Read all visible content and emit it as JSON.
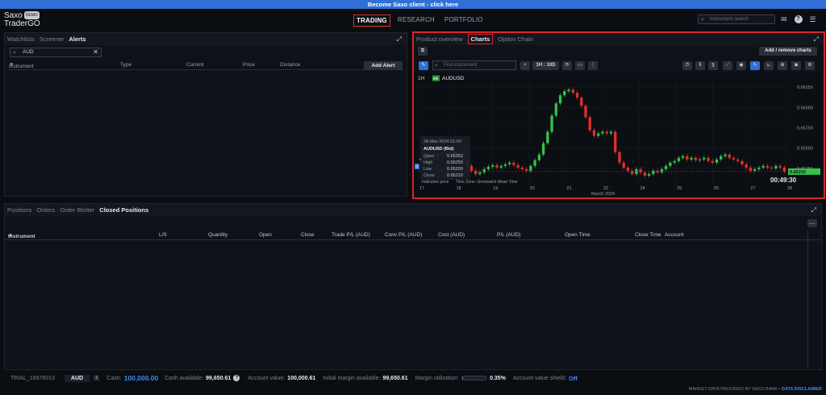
{
  "banner": {
    "text": "Become Saxo client - click here"
  },
  "logo": {
    "line1": "Saxo",
    "line2": "TraderGO",
    "badge": "DEMO"
  },
  "nav": {
    "items": [
      "TRADING",
      "RESEARCH",
      "PORTFOLIO"
    ],
    "active": "TRADING"
  },
  "top_search": {
    "placeholder": "Instrument search"
  },
  "icons": {
    "mail": "mail-icon",
    "help": "help-icon",
    "menu": "menu-icon",
    "expand": "expand-icon"
  },
  "left_panel": {
    "tabs": [
      "Watchlists",
      "Screener",
      "Alerts"
    ],
    "active_tab": "Alerts",
    "search_value": "AUD",
    "columns": [
      "Instrument",
      "Type",
      "Current",
      "Price",
      "Distance"
    ],
    "add_alert_label": "Add Alert"
  },
  "right_panel": {
    "tabs": [
      "Product overview",
      "Charts",
      "Option Chain"
    ],
    "active_tab": "Charts",
    "add_remove_label": "Add / remove charts",
    "find_placeholder": "Find instrument",
    "timeframe_label": "1H : 10D"
  },
  "chart": {
    "interval": "1H",
    "symbol_badge": "FX",
    "symbol": "AUDUSD",
    "tooltip": {
      "date": "28-Mar-2024 01:00",
      "title": "AUDUSD (Bid)",
      "rows": [
        {
          "label": "Open",
          "value": "0.65252"
        },
        {
          "label": "High",
          "value": "0.65255"
        },
        {
          "label": "Low",
          "value": "0.65209"
        },
        {
          "label": "Close",
          "value": "0.65210"
        }
      ]
    },
    "indicative": "Indicative price",
    "timezone": "Time Zone: Greenwich Mean Time",
    "countdown": "00:49:30",
    "current_price_label": "0.65210",
    "month_label": "March 2024"
  },
  "chart_data": {
    "type": "candlestick",
    "title": "AUDUSD",
    "x_ticks": [
      "17",
      "18",
      "19",
      "20",
      "21",
      "22",
      "24",
      "25",
      "26",
      "27",
      "28"
    ],
    "y_ticks": [
      0.6525,
      0.655,
      0.6575,
      0.66,
      0.6625
    ],
    "ylim": [
      0.6505,
      0.6638
    ],
    "current_price": 0.6521,
    "series": [
      {
        "name": "AUDUSD (Bid)",
        "values": [
          0.6537,
          0.6539,
          0.6541,
          0.654,
          0.6542,
          0.6543,
          0.6544,
          0.6546,
          0.6542,
          0.6538,
          0.6535,
          0.6528,
          0.6522,
          0.6518,
          0.652,
          0.6524,
          0.6527,
          0.6529,
          0.6526,
          0.6528,
          0.653,
          0.6532,
          0.6529,
          0.6526,
          0.6524,
          0.6522,
          0.6528,
          0.6535,
          0.6542,
          0.6556,
          0.657,
          0.659,
          0.6605,
          0.6615,
          0.662,
          0.6622,
          0.6618,
          0.6612,
          0.6602,
          0.6588,
          0.6572,
          0.6565,
          0.6568,
          0.657,
          0.6568,
          0.657,
          0.6545,
          0.6532,
          0.6526,
          0.6522,
          0.6518,
          0.6524,
          0.652,
          0.6516,
          0.6518,
          0.6522,
          0.652,
          0.6524,
          0.6528,
          0.6532,
          0.6534,
          0.6538,
          0.654,
          0.6536,
          0.6538,
          0.6535,
          0.6536,
          0.6538,
          0.6534,
          0.6532,
          0.6536,
          0.654,
          0.6542,
          0.6538,
          0.6536,
          0.6534,
          0.653,
          0.6526,
          0.6522,
          0.6524,
          0.6526,
          0.6528,
          0.6526,
          0.6525,
          0.6528,
          0.6526,
          0.6521
        ]
      }
    ]
  },
  "bottom_panel": {
    "tabs": [
      "Positions",
      "Orders",
      "Order Blotter",
      "Closed Positions"
    ],
    "active_tab": "Closed Positions",
    "columns": [
      "Instrument",
      "L/S",
      "Quantity",
      "Open",
      "Close",
      "Trade P/L (AUD)",
      "Conv P/L (AUD)",
      "Cost (AUD)",
      "P/L (AUD)",
      "Open Time",
      "Close Time",
      "Account"
    ]
  },
  "footer": {
    "account": "TRIAL_18976013",
    "currency": "AUD",
    "info_icon": "i",
    "cash_label": "Cash:",
    "cash_value": "100,000.00",
    "cash_available_label": "Cash available:",
    "cash_available_value": "99,650.61",
    "account_value_label": "Account value:",
    "account_value": "100,000.61",
    "initial_margin_label": "Initial margin available:",
    "initial_margin_value": "99,650.61",
    "margin_util_label": "Margin utilization:",
    "margin_util_value": "0.35%",
    "margin_util_fraction": 0.0035,
    "shield_label": "Account value shield:",
    "shield_value": "Off"
  },
  "disclaimer": {
    "text": "MARKET DATA PROVIDED BY SAXO BANK •",
    "link": "DATA DISCLAIMER"
  }
}
